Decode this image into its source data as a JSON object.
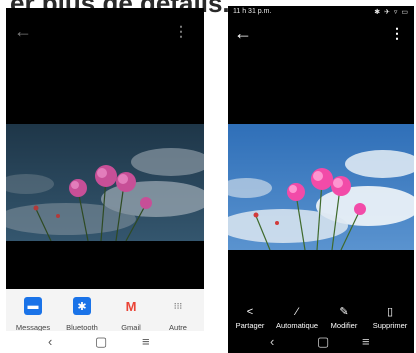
{
  "page": {
    "heading": "er plus de détails."
  },
  "left_phone": {
    "icons": {
      "back": "arrow-back-icon",
      "menu": "more-vert-icon"
    },
    "share_sheet": {
      "targets": [
        {
          "label": "Messages",
          "icon": "messages-icon",
          "color": "#1a73e8"
        },
        {
          "label": "Bluetooth",
          "icon": "bluetooth-icon",
          "color": "#1a73e8"
        },
        {
          "label": "Gmail",
          "icon": "gmail-icon",
          "color": "#ea4335"
        },
        {
          "label": "Autre",
          "icon": "more-apps-icon",
          "color": "#444444"
        }
      ]
    },
    "nav": {
      "back": "back-icon",
      "home": "home-icon",
      "recents": "menu-icon"
    }
  },
  "right_phone": {
    "status_bar": {
      "time": "11 h 31 p.m.",
      "right_icons": "✱ ✈ ▿ ▭"
    },
    "icons": {
      "back": "arrow-back-icon",
      "menu": "more-vert-icon"
    },
    "actions": [
      {
        "label": "Partager",
        "icon": "share-icon"
      },
      {
        "label": "Automatique",
        "icon": "auto-enhance-icon"
      },
      {
        "label": "Modifier",
        "icon": "edit-icon"
      },
      {
        "label": "Supprimer",
        "icon": "delete-icon"
      }
    ],
    "nav": {
      "back": "back-icon",
      "home": "home-icon",
      "recents": "menu-icon"
    }
  }
}
